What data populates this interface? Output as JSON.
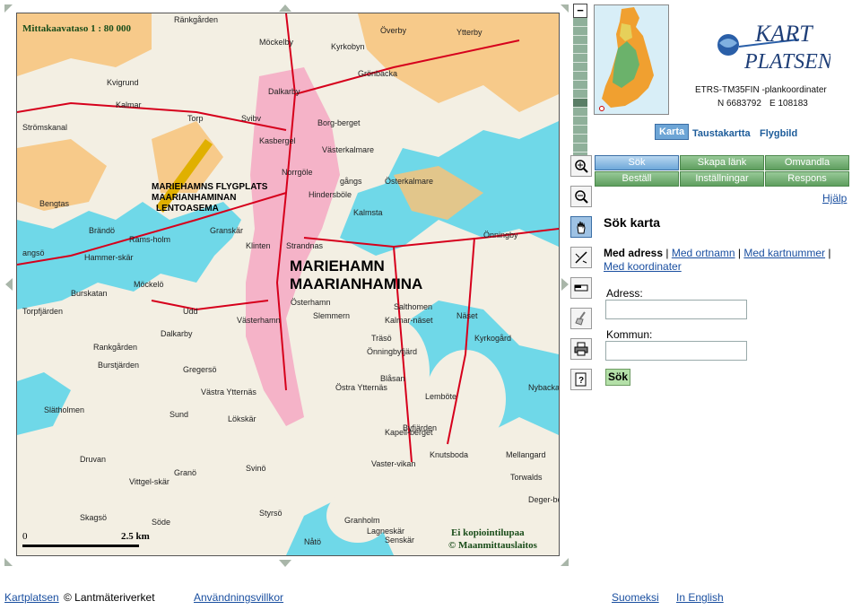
{
  "map": {
    "scale_label": "Mittakaavataso 1 : 80 000",
    "city_name_sv": "MARIEHAMN",
    "city_name_fi": "MAARIANHAMINA",
    "airport_label_1": "MARIEHAMNS FLYGPLATS",
    "airport_label_2": "MAARIANHAMINAN",
    "airport_label_3": "LENTOASEMA",
    "place_names": [
      "Möckelby",
      "Kyrkobyn",
      "Överby",
      "Ytterby",
      "Grönbacka",
      "Dalkarby",
      "Torp",
      "Svibv",
      "Kasbergel",
      "Borg-berget",
      "Västerkalmare",
      "Norrgöle",
      "Hindersböle",
      "Österkalmare",
      "Kalmsta",
      "Önningby",
      "Klinten",
      "Strandnas",
      "Österhamn",
      "Västerhamn",
      "Slemmern",
      "Kalmar-näset",
      "Näset",
      "Lemböte",
      "Knutsboda",
      "Mellangard",
      "Rankgården",
      "Gregersö",
      "Västra Ytternäs",
      "Östra Ytternäs",
      "Lökskär",
      "Svinö",
      "Styrsö",
      "Granholm",
      "Senskär",
      "Nåtö",
      "Bengtas",
      "Brändö",
      "Rams-holm",
      "Burskatan",
      "Möckelö",
      "Udd",
      "Druvan",
      "Vittgel-skär",
      "Granö",
      "Skagsö",
      "Träsö",
      "Blåsan",
      "Kapell-berget",
      "Byfjärden",
      "Torwalds",
      "Deger-berget",
      "Nybacka",
      "Sund",
      "Dalkarby",
      "Söde",
      "Vaster-vikan",
      "Önningbyfjärd",
      "Lagneskär",
      "Hammer-skär",
      "Granskär",
      "Slätholmen",
      "Salthomen",
      "Kyrkogård",
      "Burstjärden",
      "Torpfjärden",
      "Kvigrund",
      "Kalmar",
      "Strömskanal",
      "Ränkgården",
      "gångs",
      "angsö"
    ],
    "scalebar_zero": "0",
    "scalebar_value": "2.5 km",
    "copy_note": "Ei kopiointilupaa",
    "copyright": "© Maanmittauslaitos"
  },
  "zoom": {
    "plus": "+",
    "minus": "−",
    "levels": 16,
    "selected_level": 9
  },
  "tools": [
    "zoom-in-icon",
    "zoom-out-icon",
    "pan-hand-icon",
    "measure-icon",
    "scale-ruler-icon",
    "clear-broom-icon",
    "print-icon",
    "help-info-icon"
  ],
  "coords": {
    "system": "ETRS-TM35FIN -plankoordinater",
    "north": "N 6683792",
    "east": "E 108183"
  },
  "logo": {
    "word1": "KART",
    "word2": "PLATSEN"
  },
  "map_types": [
    "Karta",
    "Taustakartta",
    "Flygbild"
  ],
  "functions": {
    "row1": [
      "Sök",
      "Skapa länk",
      "Omvandla"
    ],
    "row2": [
      "Beställ",
      "Inställningar",
      "Respons"
    ]
  },
  "help": "Hjälp",
  "search": {
    "title": "Sök karta",
    "mode_current": "Med adress",
    "mode_links": [
      "Med ortnamn",
      "Med kartnummer",
      "Med koordinater"
    ],
    "sep": "|",
    "address_label": "Adress:",
    "address_value": "",
    "municipality_label": "Kommun:",
    "municipality_value": "",
    "submit": "Sök"
  },
  "footer": {
    "site": "Kartplatsen",
    "owner": "© Lantmäteriverket",
    "terms": "Användningsvillkor",
    "lang1": "Suomeksi",
    "lang2": "In English"
  },
  "colors": {
    "water": "#6fd8e8",
    "land": "#f3efe3",
    "field": "#f7c37a",
    "urban": "#f5b3c8",
    "road": "#d6001c",
    "accent": "#3a6ea5",
    "button_green": "#5e9e5e"
  }
}
